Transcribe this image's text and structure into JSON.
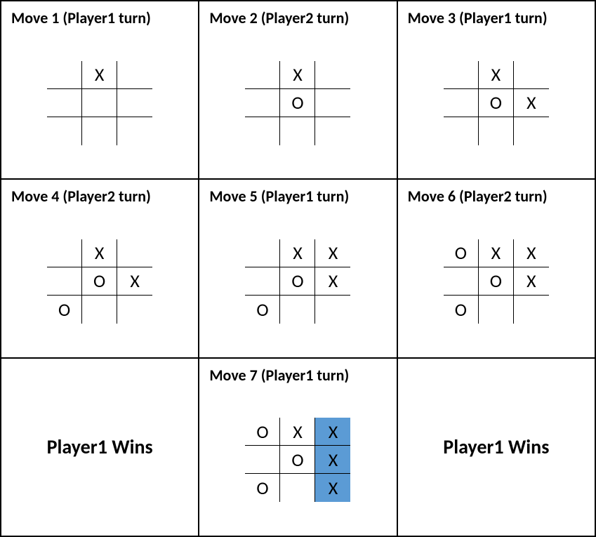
{
  "moves": [
    {
      "title": "Move 1 (Player1 turn)",
      "board": [
        [
          "",
          "X",
          ""
        ],
        [
          "",
          "",
          ""
        ],
        [
          "",
          "",
          ""
        ]
      ],
      "highlight": []
    },
    {
      "title": "Move 2 (Player2 turn)",
      "board": [
        [
          "",
          "X",
          ""
        ],
        [
          "",
          "O",
          ""
        ],
        [
          "",
          "",
          ""
        ]
      ],
      "highlight": []
    },
    {
      "title": "Move 3 (Player1 turn)",
      "board": [
        [
          "",
          "X",
          ""
        ],
        [
          "",
          "O",
          "X"
        ],
        [
          "",
          "",
          ""
        ]
      ],
      "highlight": []
    },
    {
      "title": "Move 4 (Player2 turn)",
      "board": [
        [
          "",
          "X",
          ""
        ],
        [
          "",
          "O",
          "X"
        ],
        [
          "O",
          "",
          ""
        ]
      ],
      "highlight": []
    },
    {
      "title": "Move 5 (Player1 turn)",
      "board": [
        [
          "",
          "X",
          "X"
        ],
        [
          "",
          "O",
          "X"
        ],
        [
          "O",
          "",
          ""
        ]
      ],
      "highlight": []
    },
    {
      "title": "Move 6 (Player2 turn)",
      "board": [
        [
          "O",
          "X",
          "X"
        ],
        [
          "",
          "O",
          "X"
        ],
        [
          "O",
          "",
          ""
        ]
      ],
      "highlight": []
    },
    {
      "title": "Move 7 (Player1 turn)",
      "board": [
        [
          "O",
          "X",
          "X"
        ],
        [
          "",
          "O",
          "X"
        ],
        [
          "O",
          "",
          "X"
        ]
      ],
      "highlight": [
        [
          0,
          2
        ],
        [
          1,
          2
        ],
        [
          2,
          2
        ]
      ]
    }
  ],
  "result_text": "Player1 Wins"
}
